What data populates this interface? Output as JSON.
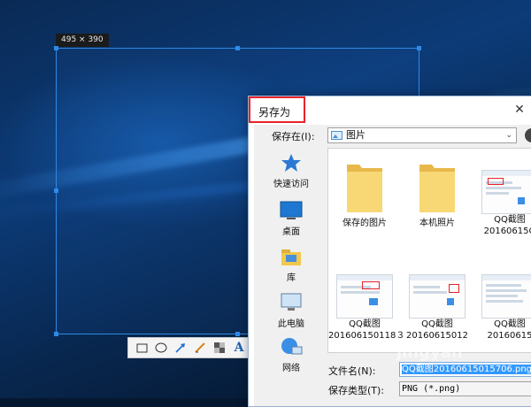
{
  "capture": {
    "size_label": "495 × 390"
  },
  "toolbar": {
    "tools": [
      {
        "icon": "rectangle-tool-icon",
        "label": ""
      },
      {
        "icon": "ellipse-tool-icon",
        "label": ""
      },
      {
        "icon": "arrow-tool-icon",
        "label": ""
      },
      {
        "icon": "pen-tool-icon",
        "label": ""
      },
      {
        "icon": "mosaic-tool-icon",
        "label": ""
      },
      {
        "icon": "text-tool-icon",
        "label": "A"
      }
    ]
  },
  "dialog": {
    "title": "另存为",
    "close_glyph": "✕",
    "save_in_label": "保存在(I):",
    "save_in_value": "图片",
    "places": [
      {
        "label": "快速访问",
        "icon": "star-icon"
      },
      {
        "label": "桌面",
        "icon": "desktop-icon"
      },
      {
        "label": "库",
        "icon": "library-icon"
      },
      {
        "label": "此电脑",
        "icon": "computer-icon"
      },
      {
        "label": "网络",
        "icon": "network-icon"
      }
    ],
    "files": [
      {
        "label": "保存的图片",
        "label2": "",
        "type": "folder"
      },
      {
        "label": "本机照片",
        "label2": "",
        "type": "folder"
      },
      {
        "label": "QQ截图",
        "label2": "20160615O",
        "type": "image"
      },
      {
        "label": "QQ截图",
        "label2": "201606150118３",
        "type": "image"
      },
      {
        "label": "QQ截图",
        "label2": "20160615012",
        "type": "image"
      },
      {
        "label": "QQ截图",
        "label2": "20160615",
        "type": "image"
      }
    ],
    "filename_label": "文件名(N):",
    "filename_value": "QQ截图20160615015706.png",
    "filetype_label": "保存类型(T):",
    "filetype_value": "PNG (*.png)"
  },
  "watermark": "jingyan"
}
